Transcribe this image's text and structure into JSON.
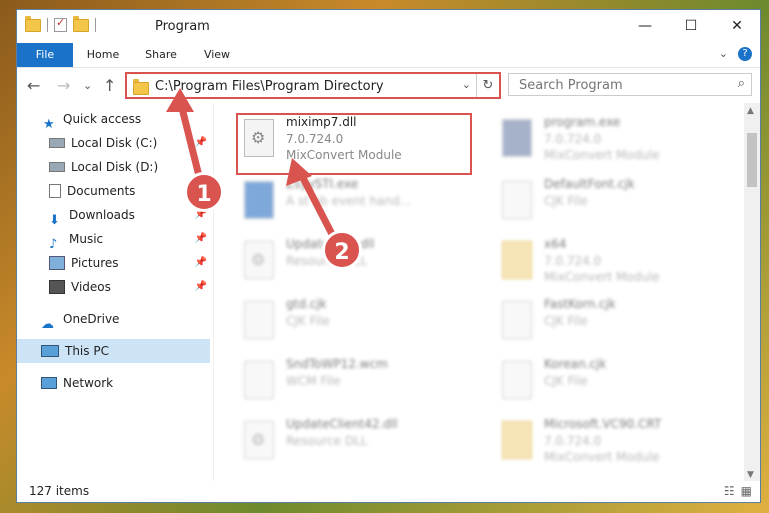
{
  "window": {
    "title": "Program",
    "controls": {
      "minimize": "—",
      "maximize": "☐",
      "close": "✕"
    }
  },
  "ribbon": {
    "tabs": [
      {
        "label": "File"
      },
      {
        "label": "Home"
      },
      {
        "label": "Share"
      },
      {
        "label": "View"
      }
    ],
    "expand": "⌄",
    "help": "?"
  },
  "nav": {
    "back": "←",
    "forward": "→",
    "recent": "⌄",
    "up": "↑",
    "address": "C:\\Program Files\\Program Directory",
    "address_dropdown": "⌄",
    "refresh": "↻",
    "search_placeholder": "Search Program",
    "search_icon": "⌕"
  },
  "sidebar": {
    "items": [
      {
        "label": "Quick access",
        "icon": "star-icon"
      },
      {
        "label": "Local Disk (C:)",
        "icon": "drive-icon"
      },
      {
        "label": "Local Disk (D:)",
        "icon": "drive-icon"
      },
      {
        "label": "Documents",
        "icon": "documents-icon"
      },
      {
        "label": "Downloads",
        "icon": "download-icon"
      },
      {
        "label": "Music",
        "icon": "music-icon"
      },
      {
        "label": "Pictures",
        "icon": "pictures-icon"
      },
      {
        "label": "Videos",
        "icon": "videos-icon"
      },
      {
        "label": "OneDrive",
        "icon": "cloud-icon"
      },
      {
        "label": "This PC",
        "icon": "computer-icon"
      },
      {
        "label": "Network",
        "icon": "network-icon"
      }
    ]
  },
  "files": {
    "highlighted": {
      "name": "miximp7.dll",
      "version": "7.0.724.0",
      "description": "MixConvert Module"
    },
    "left": [
      {
        "name": "ZsyySTI.exe",
        "line2": "A st ob event hand..."
      },
      {
        "name": "Update...63.dll",
        "line2": "Resource DLL"
      },
      {
        "name": "gtd.cjk",
        "line2": "CJK File"
      },
      {
        "name": "SndToWP12.wcm",
        "line2": "WCM File"
      },
      {
        "name": "UpdateClient42.dll",
        "line2": "Resource DLL"
      }
    ],
    "right": [
      {
        "name": "program.exe",
        "line2": "7.0.724.0",
        "line3": "MixConvert Module"
      },
      {
        "name": "DefaultFont.cjk",
        "line2": "CJK File"
      },
      {
        "name": "x64",
        "line2": "7.0.724.0",
        "line3": "MixConvert Module"
      },
      {
        "name": "FastKorn.cjk",
        "line2": "CJK File"
      },
      {
        "name": "Korean.cjk",
        "line2": "CJK File"
      },
      {
        "name": "Microsoft.VC90.CRT",
        "line2": "7.0.724.0",
        "line3": "MixConvert Module"
      }
    ]
  },
  "status": {
    "item_count": "127 items",
    "details_view": "☷",
    "tiles_view": "▦"
  },
  "annotations": {
    "step1": "1",
    "step2": "2"
  },
  "colors": {
    "accent": "#1a73c8",
    "highlight_red": "#d9534f"
  }
}
